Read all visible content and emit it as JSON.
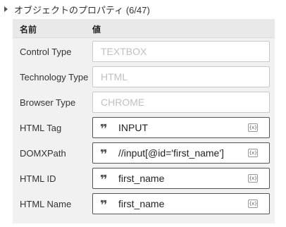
{
  "section": {
    "title": "オブジェクトのプロパティ (6/47)"
  },
  "table": {
    "header_name": "名前",
    "header_value": "値"
  },
  "rows": [
    {
      "label": "Control Type",
      "value": "TEXTBOX",
      "editable": false
    },
    {
      "label": "Technology Type",
      "value": "HTML",
      "editable": false
    },
    {
      "label": "Browser Type",
      "value": "CHROME",
      "editable": false
    },
    {
      "label": "HTML Tag",
      "value": "INPUT",
      "editable": true
    },
    {
      "label": "DOMXPath",
      "value": "//input[@id='first_name']",
      "editable": true
    },
    {
      "label": "HTML ID",
      "value": "first_name",
      "editable": true
    },
    {
      "label": "HTML Name",
      "value": "first_name",
      "editable": true
    }
  ],
  "icons": {
    "quote": "❞",
    "variable": "{x}",
    "expand": "caret-right-icon"
  }
}
